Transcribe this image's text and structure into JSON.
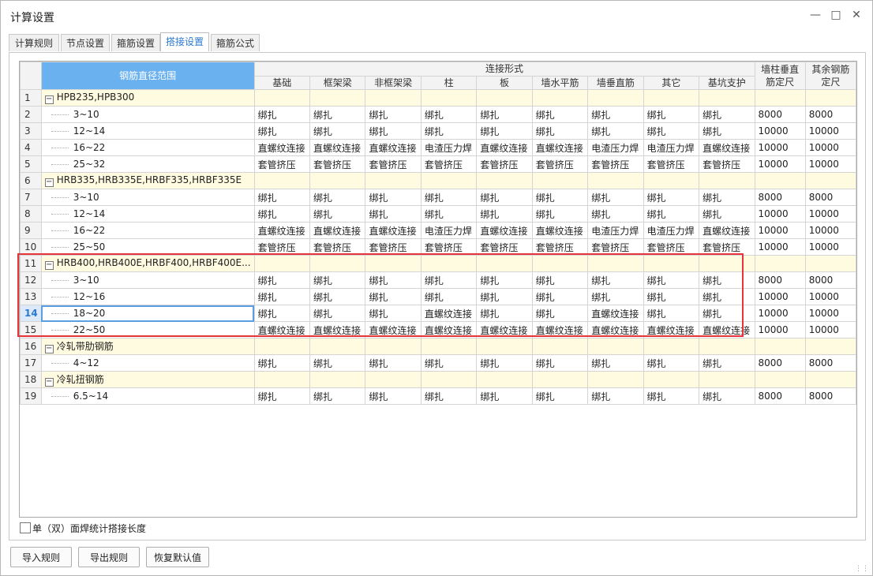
{
  "window": {
    "title": "计算设置"
  },
  "tabs": [
    {
      "label": "计算规则",
      "active": false
    },
    {
      "label": "节点设置",
      "active": false
    },
    {
      "label": "箍筋设置",
      "active": false
    },
    {
      "label": "搭接设置",
      "active": true
    },
    {
      "label": "箍筋公式",
      "active": false
    }
  ],
  "grid": {
    "headers": {
      "range": "钢筋直径范围",
      "conn_group": "连接形式",
      "cols": [
        "基础",
        "框架梁",
        "非框架梁",
        "柱",
        "板",
        "墙水平筋",
        "墙垂直筋",
        "其它",
        "基坑支护"
      ],
      "wall_col": "墙柱垂直筋定尺",
      "other_col": "其余钢筋定尺"
    },
    "rows": [
      {
        "num": "1",
        "group": true,
        "label": "HPB235,HPB300",
        "cells": [
          "",
          "",
          "",
          "",
          "",
          "",
          "",
          "",
          ""
        ],
        "wall": "",
        "other": ""
      },
      {
        "num": "2",
        "label": "3~10",
        "cells": [
          "绑扎",
          "绑扎",
          "绑扎",
          "绑扎",
          "绑扎",
          "绑扎",
          "绑扎",
          "绑扎",
          "绑扎"
        ],
        "wall": "8000",
        "other": "8000"
      },
      {
        "num": "3",
        "label": "12~14",
        "cells": [
          "绑扎",
          "绑扎",
          "绑扎",
          "绑扎",
          "绑扎",
          "绑扎",
          "绑扎",
          "绑扎",
          "绑扎"
        ],
        "wall": "10000",
        "other": "10000"
      },
      {
        "num": "4",
        "label": "16~22",
        "cells": [
          "直螺纹连接",
          "直螺纹连接",
          "直螺纹连接",
          "电渣压力焊",
          "直螺纹连接",
          "直螺纹连接",
          "电渣压力焊",
          "电渣压力焊",
          "直螺纹连接"
        ],
        "wall": "10000",
        "other": "10000"
      },
      {
        "num": "5",
        "label": "25~32",
        "cells": [
          "套管挤压",
          "套管挤压",
          "套管挤压",
          "套管挤压",
          "套管挤压",
          "套管挤压",
          "套管挤压",
          "套管挤压",
          "套管挤压"
        ],
        "wall": "10000",
        "other": "10000"
      },
      {
        "num": "6",
        "group": true,
        "label": "HRB335,HRB335E,HRBF335,HRBF335E",
        "cells": [
          "",
          "",
          "",
          "",
          "",
          "",
          "",
          "",
          ""
        ],
        "wall": "",
        "other": ""
      },
      {
        "num": "7",
        "label": "3~10",
        "cells": [
          "绑扎",
          "绑扎",
          "绑扎",
          "绑扎",
          "绑扎",
          "绑扎",
          "绑扎",
          "绑扎",
          "绑扎"
        ],
        "wall": "8000",
        "other": "8000"
      },
      {
        "num": "8",
        "label": "12~14",
        "cells": [
          "绑扎",
          "绑扎",
          "绑扎",
          "绑扎",
          "绑扎",
          "绑扎",
          "绑扎",
          "绑扎",
          "绑扎"
        ],
        "wall": "10000",
        "other": "10000"
      },
      {
        "num": "9",
        "label": "16~22",
        "cells": [
          "直螺纹连接",
          "直螺纹连接",
          "直螺纹连接",
          "电渣压力焊",
          "直螺纹连接",
          "直螺纹连接",
          "电渣压力焊",
          "电渣压力焊",
          "直螺纹连接"
        ],
        "wall": "10000",
        "other": "10000"
      },
      {
        "num": "10",
        "label": "25~50",
        "cells": [
          "套管挤压",
          "套管挤压",
          "套管挤压",
          "套管挤压",
          "套管挤压",
          "套管挤压",
          "套管挤压",
          "套管挤压",
          "套管挤压"
        ],
        "wall": "10000",
        "other": "10000"
      },
      {
        "num": "11",
        "group": true,
        "label": "HRB400,HRB400E,HRBF400,HRBF400E...",
        "cells": [
          "",
          "",
          "",
          "",
          "",
          "",
          "",
          "",
          ""
        ],
        "wall": "",
        "other": ""
      },
      {
        "num": "12",
        "label": "3~10",
        "cells": [
          "绑扎",
          "绑扎",
          "绑扎",
          "绑扎",
          "绑扎",
          "绑扎",
          "绑扎",
          "绑扎",
          "绑扎"
        ],
        "wall": "8000",
        "other": "8000"
      },
      {
        "num": "13",
        "label": "12~16",
        "cells": [
          "绑扎",
          "绑扎",
          "绑扎",
          "绑扎",
          "绑扎",
          "绑扎",
          "绑扎",
          "绑扎",
          "绑扎"
        ],
        "wall": "10000",
        "other": "10000"
      },
      {
        "num": "14",
        "label": "18~20",
        "selected": true,
        "cells": [
          "绑扎",
          "绑扎",
          "绑扎",
          "直螺纹连接",
          "绑扎",
          "绑扎",
          "直螺纹连接",
          "绑扎",
          "绑扎"
        ],
        "wall": "10000",
        "other": "10000"
      },
      {
        "num": "15",
        "label": "22~50",
        "cells": [
          "直螺纹连接",
          "直螺纹连接",
          "直螺纹连接",
          "直螺纹连接",
          "直螺纹连接",
          "直螺纹连接",
          "直螺纹连接",
          "直螺纹连接",
          "直螺纹连接"
        ],
        "wall": "10000",
        "other": "10000"
      },
      {
        "num": "16",
        "group": true,
        "label": "冷轧带肋钢筋",
        "cells": [
          "",
          "",
          "",
          "",
          "",
          "",
          "",
          "",
          ""
        ],
        "wall": "",
        "other": ""
      },
      {
        "num": "17",
        "label": "4~12",
        "cells": [
          "绑扎",
          "绑扎",
          "绑扎",
          "绑扎",
          "绑扎",
          "绑扎",
          "绑扎",
          "绑扎",
          "绑扎"
        ],
        "wall": "8000",
        "other": "8000"
      },
      {
        "num": "18",
        "group": true,
        "label": "冷轧扭钢筋",
        "cells": [
          "",
          "",
          "",
          "",
          "",
          "",
          "",
          "",
          ""
        ],
        "wall": "",
        "other": ""
      },
      {
        "num": "19",
        "label": "6.5~14",
        "cells": [
          "绑扎",
          "绑扎",
          "绑扎",
          "绑扎",
          "绑扎",
          "绑扎",
          "绑扎",
          "绑扎",
          "绑扎"
        ],
        "wall": "8000",
        "other": "8000"
      }
    ]
  },
  "checkbox": {
    "label": "单（双）面焊统计搭接长度",
    "checked": false
  },
  "buttons": {
    "import": "导入规则",
    "export": "导出规则",
    "restore": "恢复默认值"
  },
  "colors": {
    "accent": "#2b79d0",
    "header_range": "#6ab1f0",
    "group_row": "#fffbe0",
    "highlight": "#e8333a"
  }
}
